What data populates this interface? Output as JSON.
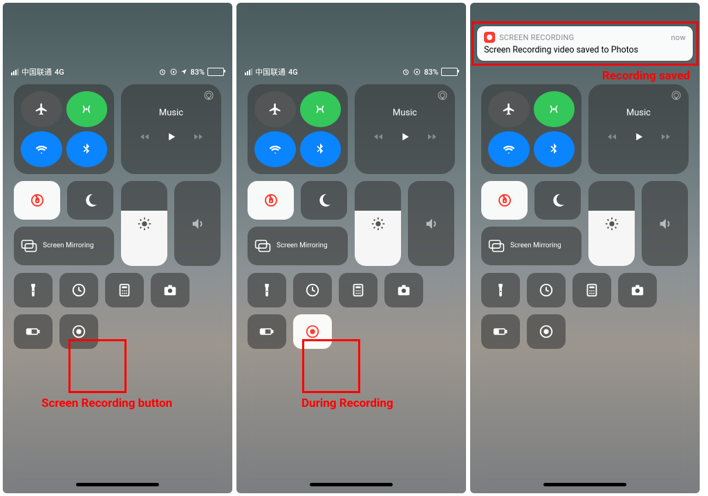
{
  "status": {
    "carrier": "中国联通",
    "network": "4G",
    "battery_pct": "83%"
  },
  "music": {
    "label": "Music"
  },
  "mirror": {
    "label": "Screen Mirroring"
  },
  "notification": {
    "app": "SCREEN RECORDING",
    "time": "now",
    "message": "Screen Recording video saved to Photos"
  },
  "captions": {
    "button": "Screen Recording button",
    "during": "During Recording",
    "saved": "Recording saved"
  },
  "colors": {
    "accent_green": "#34c759",
    "accent_blue": "#0a84ff",
    "accent_red": "#ff3b30",
    "annotation_red": "#ff0000"
  }
}
